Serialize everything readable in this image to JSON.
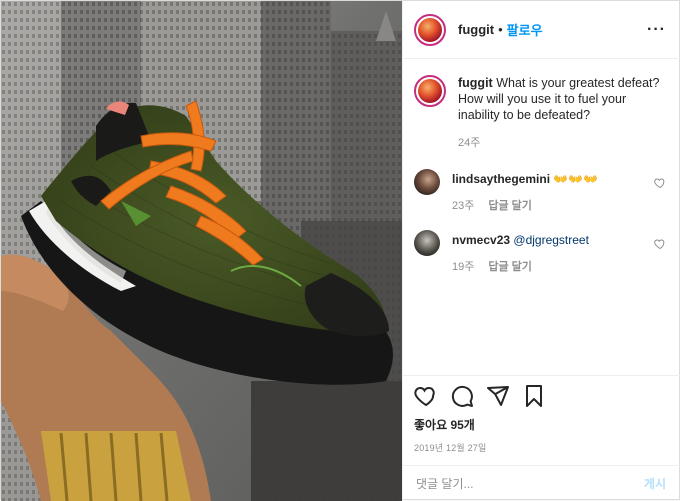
{
  "post": {
    "username": "fuggit",
    "separator": "•",
    "follow_label": "팔로우",
    "more_label": "···"
  },
  "caption": {
    "username": "fuggit",
    "text": "What is your greatest defeat? How will you use it to fuel your inability to be defeated?",
    "time": "24주"
  },
  "comments": [
    {
      "username": "lindsaythegemini",
      "text": "👐👐👐",
      "time": "23주",
      "reply_label": "답글 달기"
    },
    {
      "username": "nvmecv23",
      "text": "@djgregstreet",
      "time": "19주",
      "reply_label": "답글 달기"
    }
  ],
  "actions": {
    "icons": [
      "heart-icon",
      "comment-icon",
      "share-icon",
      "bookmark-icon"
    ],
    "likes_label": "좋아요 95개",
    "date": "2019년 12월 27일"
  },
  "add_comment": {
    "placeholder": "댓글 달기...",
    "post_label": "게시"
  },
  "colors": {
    "link": "#0095f6",
    "post_disabled": "#b2dffc",
    "shoe_body": "#3c4a1e",
    "laces": "#f07a1e",
    "sole_white": "#f2f2f0"
  }
}
